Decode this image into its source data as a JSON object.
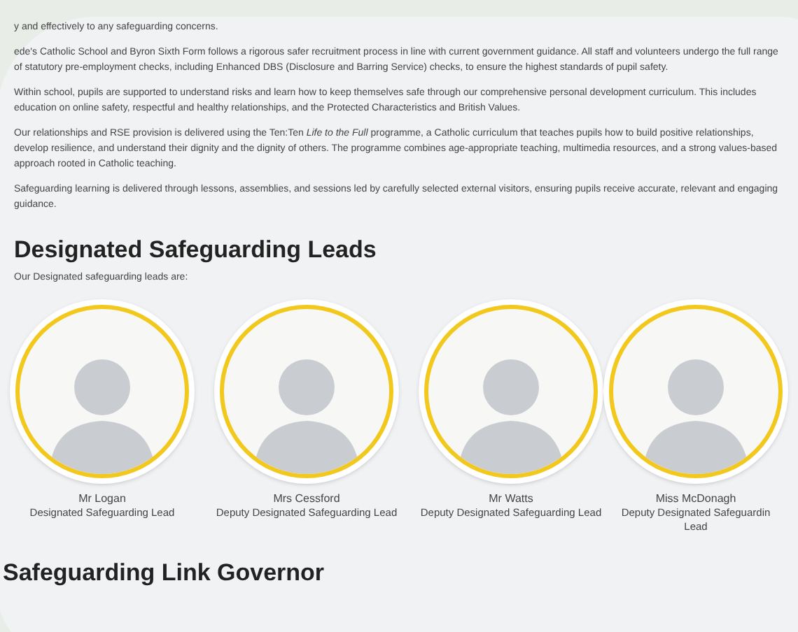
{
  "intro_paragraphs": [
    "y and effectively to any safeguarding concerns.",
    "ede's Catholic School and Byron Sixth Form follows a rigorous safer recruitment process in line with current government guidance. All staff and volunteers undergo the full range of statutory pre-employment checks, including Enhanced DBS (Disclosure and Barring Service) checks, to ensure the highest standards of pupil safety.",
    "Within school, pupils are supported to understand risks and learn how to keep themselves safe through our comprehensive personal development curriculum. This includes education on online safety, respectful and healthy relationships, and the Protected Characteristics and British Values.",
    "Our relationships and RSE provision is delivered using the Ten:Ten *Life to the Full* programme, a Catholic curriculum that teaches pupils how to build positive relationships, develop resilience, and understand their dignity and the dignity of others. The programme combines age-appropriate teaching, multimedia resources, and a strong values-based approach rooted in Catholic teaching.",
    "Safeguarding learning is delivered through lessons, assemblies, and sessions led by carefully selected external visitors, ensuring pupils receive accurate, relevant and engaging guidance."
  ],
  "leads_section": {
    "heading": "Designated Safeguarding Leads",
    "intro": "Our Designated safeguarding leads are:",
    "people": [
      {
        "name": "Mr Logan",
        "role": "Designated Safeguarding Lead"
      },
      {
        "name": "Mrs Cessford",
        "role": "Deputy Designated Safeguarding Lead"
      },
      {
        "name": "Mr Watts",
        "role": "Deputy Designated Safeguarding Lead"
      },
      {
        "name": "Miss McDonagh",
        "role": "Deputy Designated Safeguardin Lead"
      }
    ]
  },
  "governor_section": {
    "heading": "Safeguarding Link Governor"
  }
}
